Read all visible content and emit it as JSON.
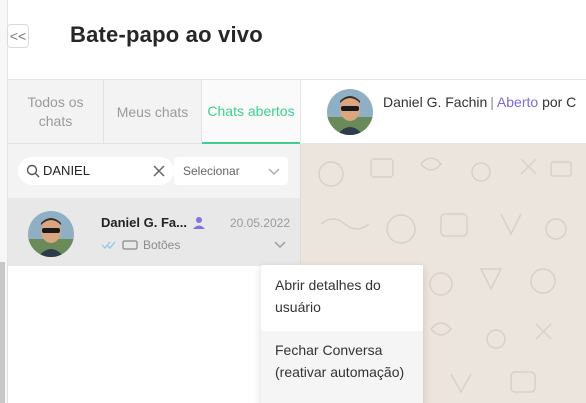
{
  "header": {
    "collapse_label": "<<",
    "title": "Bate-papo ao vivo"
  },
  "tabs": [
    {
      "label": "Todos os chats"
    },
    {
      "label": "Meus chats"
    },
    {
      "label": "Chats abertos"
    }
  ],
  "chat_header": {
    "name": "Daniel G. Fachin",
    "separator": "|",
    "status": "Aberto",
    "suffix": "por C"
  },
  "filters": {
    "search_value": "DANIEL",
    "select_label": "Selecionar"
  },
  "conversation": {
    "name": "Daniel G. Fa...",
    "date": "20.05.2022",
    "channel": "Botões"
  },
  "context_menu": {
    "items": [
      {
        "label": "Abrir detalhes do usuário"
      },
      {
        "label": "Fechar Conversa (reativar automação)"
      }
    ]
  },
  "colors": {
    "accent_green": "#3fcf8e",
    "status_purple": "#7b6cd9",
    "wallpaper": "#ece5dd"
  },
  "icons": [
    "collapse-icon",
    "search-icon",
    "clear-icon",
    "chevron-down-icon",
    "user-icon",
    "double-check-icon",
    "button-channel-icon"
  ]
}
